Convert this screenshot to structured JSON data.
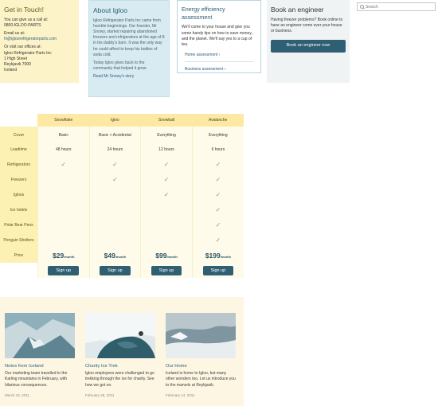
{
  "contact": {
    "title": "Get in Touch!",
    "call_text": "You can give us a call at:",
    "phone": "0800-IGLOO-PARTS",
    "email_label": "Email us at:",
    "email": "hi@igloorefrigeratorparts.com",
    "visit_text": "Or visit our offices at:",
    "address_lines": [
      "Igloo Refrigerator Parts Inc",
      "1 High Street",
      "Reykjavik 7000",
      "Iceland"
    ]
  },
  "about": {
    "title": "About Igloo",
    "p1": "Igloo Refrigerator Parts Inc came from humble beginnings. Our founder, Mr Snowy, started repairing abandoned freezers and refrigerators at the age of 8 in his daddy's barn. It was the only way he could afford to keep his bottles of soda cold.",
    "p2": "Today Igloo gives back to the community that helped it grow.",
    "link": "Read Mr Snowy's story"
  },
  "energy": {
    "title": "Energy efficiency assessment",
    "text": "We'll come to your house and give you some handy tips on how to save money, and the planet. We'll say yes to a cup of tea.",
    "links": [
      "Home assessment ›",
      "Business assessment ›"
    ]
  },
  "engineer": {
    "title": "Book an engineer",
    "text": "Having freezer problems? Book online to have an engineer come over your house or business.",
    "button": "Book an engineer now"
  },
  "search": {
    "placeholder": "Search",
    "icon": "search-icon"
  },
  "pricing": {
    "plans": [
      "Snowflake",
      "Igloo",
      "Snowball",
      "Avalanche"
    ],
    "rows": [
      {
        "label": "Cover",
        "values": [
          "Basic",
          "Basic + Accidental",
          "Everything",
          "Everything"
        ]
      },
      {
        "label": "Leadtime",
        "values": [
          "48 hours",
          "24 hours",
          "12 hours",
          "6 hours"
        ]
      },
      {
        "label": "Refrigerators",
        "checks": [
          true,
          true,
          true,
          true
        ]
      },
      {
        "label": "Freezers",
        "checks": [
          false,
          true,
          true,
          true
        ]
      },
      {
        "label": "Igloos",
        "checks": [
          false,
          false,
          true,
          true
        ]
      },
      {
        "label": "Ice hotels",
        "checks": [
          false,
          false,
          false,
          true
        ]
      },
      {
        "label": "Polar Bear Pens",
        "checks": [
          false,
          false,
          false,
          true
        ]
      },
      {
        "label": "Penguin Shelters",
        "checks": [
          false,
          false,
          false,
          true
        ]
      }
    ],
    "price_label": "Price",
    "prices": [
      "$29",
      "$49",
      "$99",
      "$199"
    ],
    "per": "/month",
    "signup": "Sign up"
  },
  "news": [
    {
      "title": "Notes from Iceland",
      "text": "Our marketing team travelled to the Karling mountains in February, with hilarious consequences.",
      "date": "March 16, 2011"
    },
    {
      "title": "Charity Ice Trek",
      "text": "Igloo employees were challenged to go trekking through the ice for charity. See how we got on.",
      "date": "February 28, 2011"
    },
    {
      "title": "Our Home",
      "text": "Iceland is home to Igloo, but many other wonders too. Let us introduce you to the marvels at Reykjavik.",
      "date": "February 14, 2011"
    }
  ]
}
